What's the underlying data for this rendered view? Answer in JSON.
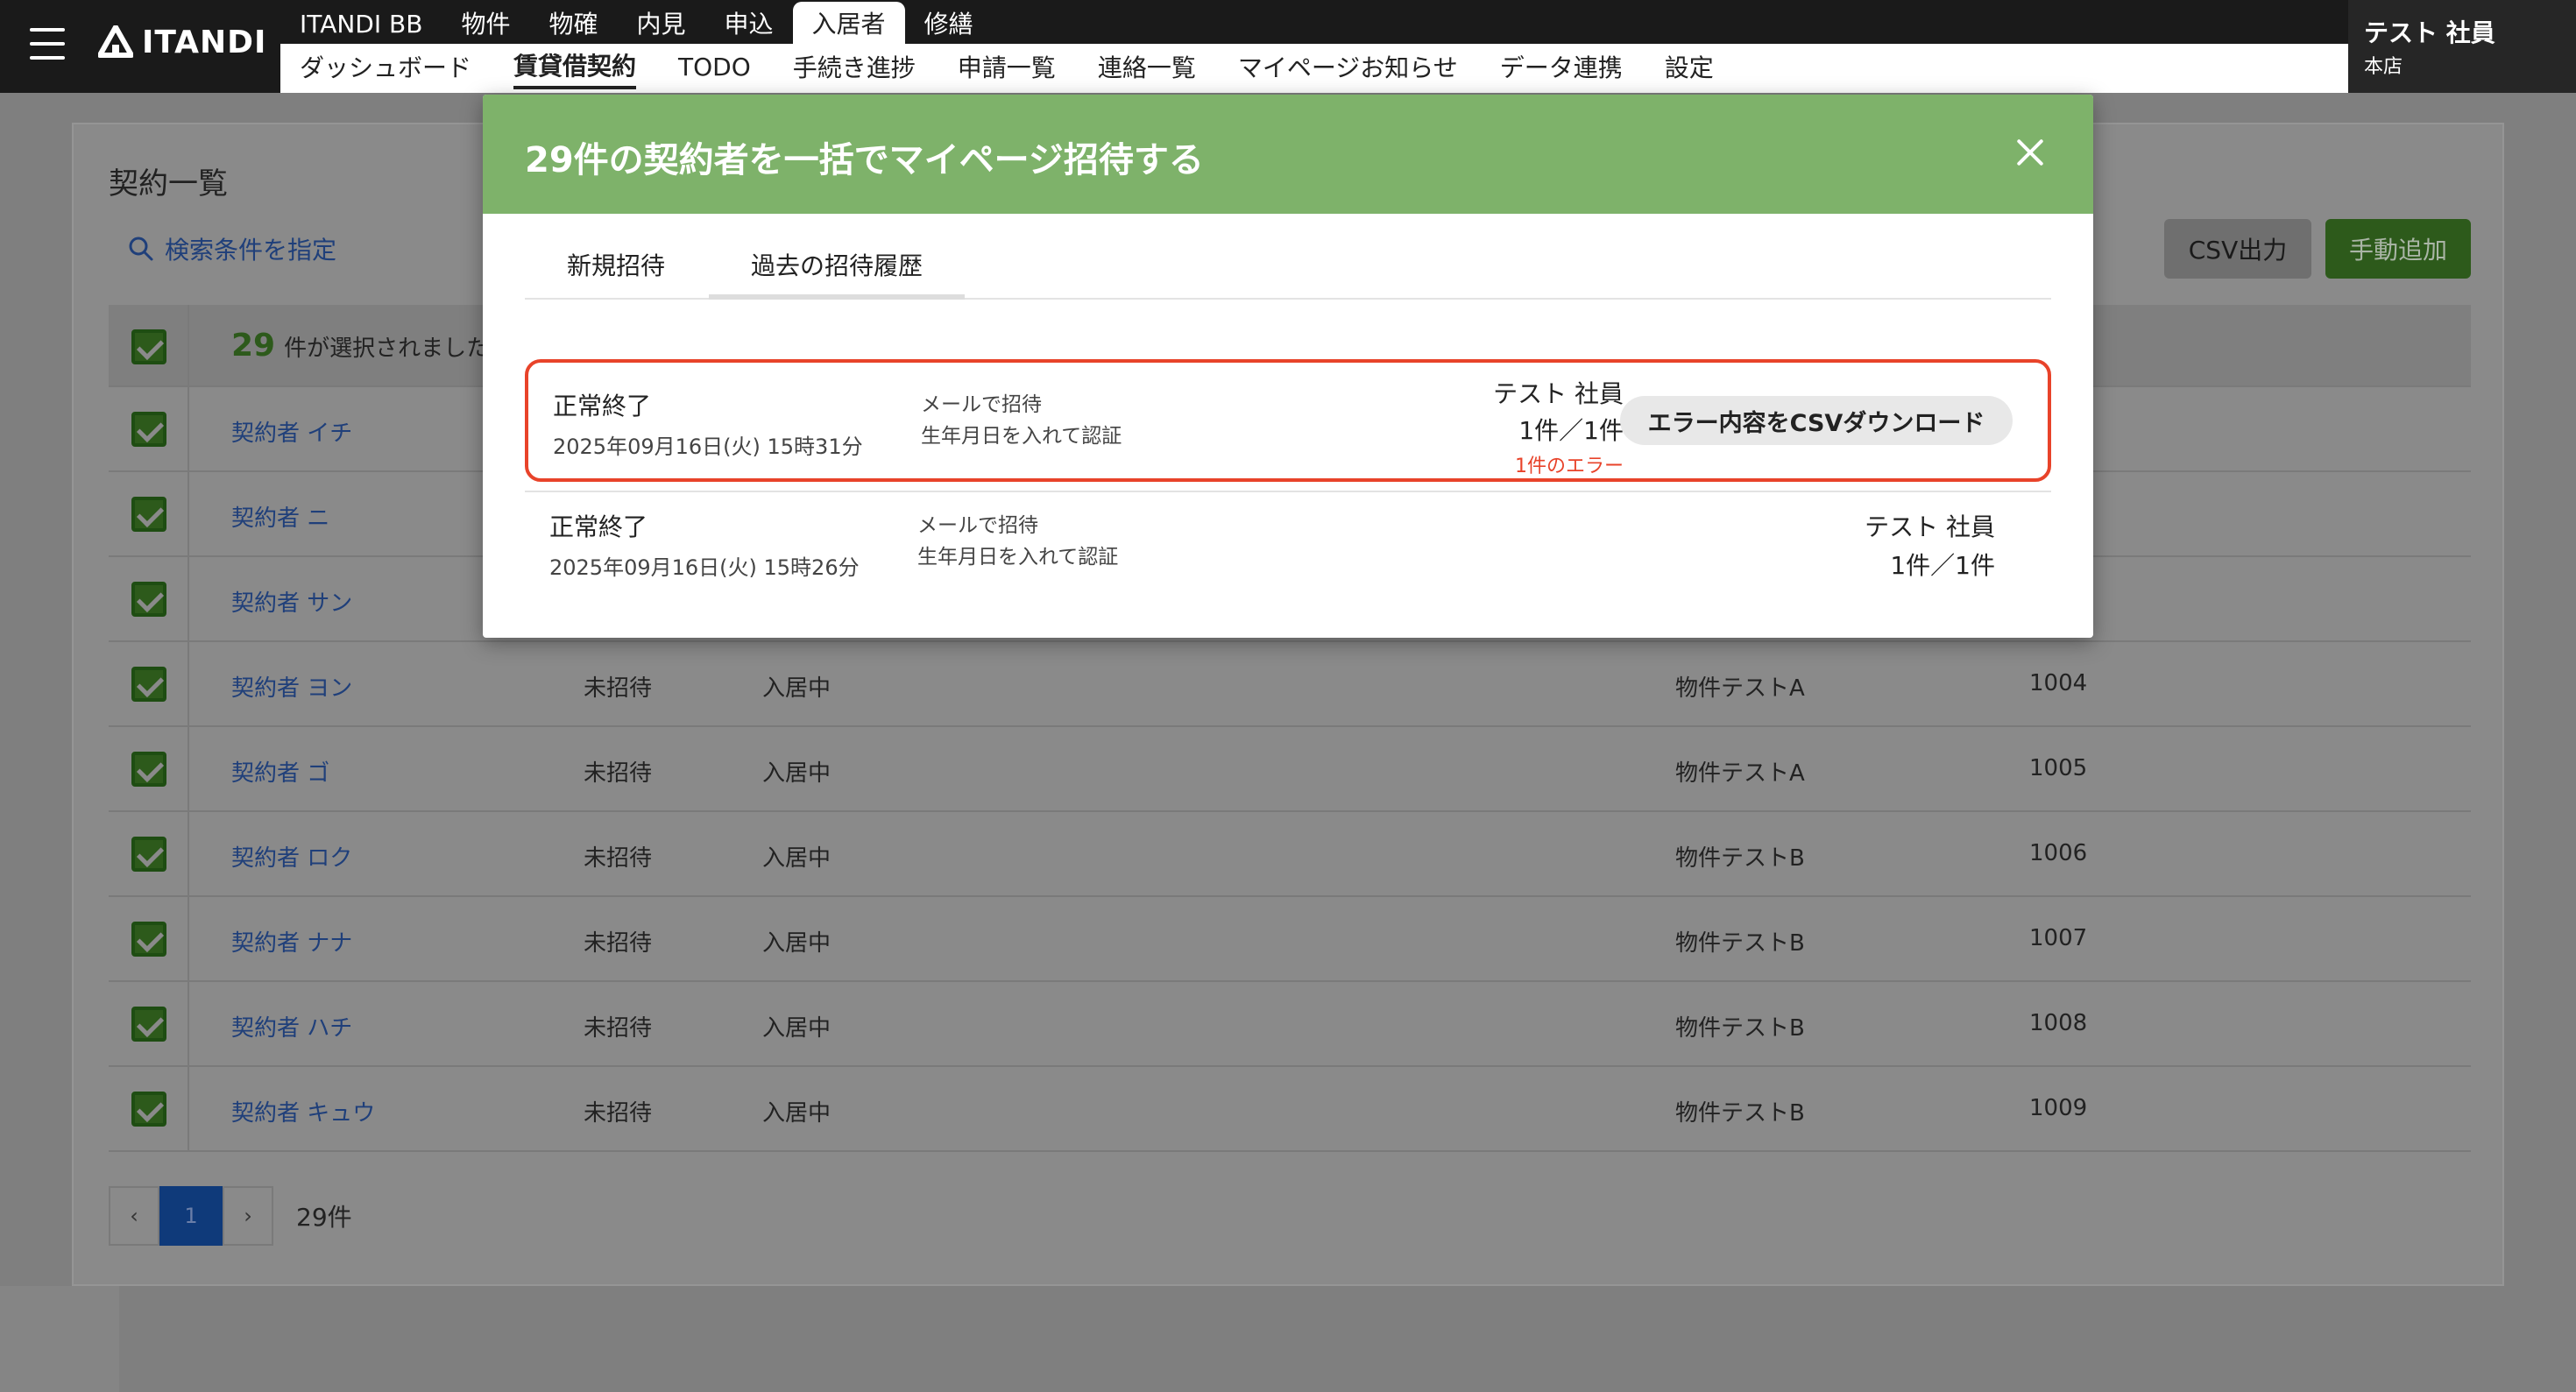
{
  "header": {
    "logo_text": "ITANDI",
    "top_tabs": [
      "ITANDI BB",
      "物件",
      "物確",
      "内見",
      "申込",
      "入居者",
      "修繕"
    ],
    "sub_nav": [
      "ダッシュボード",
      "賃貸借契約",
      "TODO",
      "手続き進捗",
      "申請一覧",
      "連絡一覧",
      "マイページお知らせ",
      "データ連携",
      "設定"
    ],
    "user_name": "テスト 社員",
    "user_store": "本店"
  },
  "page": {
    "title": "契約一覧",
    "search_label": "検索条件を指定",
    "csv_button": "CSV出力",
    "add_button": "手動追加",
    "selected_count": "29",
    "selected_suffix": "件が選択されました",
    "rows": [
      {
        "name": "契約者 イチ",
        "status": "",
        "state": "",
        "property": "",
        "room": ""
      },
      {
        "name": "契約者 ニ",
        "status": "",
        "state": "",
        "property": "",
        "room": ""
      },
      {
        "name": "契約者 サン",
        "status": "",
        "state": "",
        "property": "",
        "room": ""
      },
      {
        "name": "契約者 ヨン",
        "status": "未招待",
        "state": "入居中",
        "property": "物件テストA",
        "room": "1004"
      },
      {
        "name": "契約者 ゴ",
        "status": "未招待",
        "state": "入居中",
        "property": "物件テストA",
        "room": "1005"
      },
      {
        "name": "契約者 ロク",
        "status": "未招待",
        "state": "入居中",
        "property": "物件テストB",
        "room": "1006"
      },
      {
        "name": "契約者 ナナ",
        "status": "未招待",
        "state": "入居中",
        "property": "物件テストB",
        "room": "1007"
      },
      {
        "name": "契約者 ハチ",
        "status": "未招待",
        "state": "入居中",
        "property": "物件テストB",
        "room": "1008"
      },
      {
        "name": "契約者 キュウ",
        "status": "未招待",
        "state": "入居中",
        "property": "物件テストB",
        "room": "1009"
      }
    ],
    "pager": {
      "prev": "‹",
      "current": "1",
      "next": "›",
      "total": "29件"
    }
  },
  "modal": {
    "title": "29件の契約者を一括でマイページ招待する",
    "tabs": [
      "新規招待",
      "過去の招待履歴"
    ],
    "active_tab": "過去の招待履歴",
    "history": [
      {
        "status": "正常終了",
        "date": "2025年09月16日(火) 15時31分",
        "method_1": "メールで招待",
        "method_2": "生年月日を入れて認証",
        "user": "テスト 社員",
        "count": "1件／1件",
        "error": "1件のエラー",
        "download": "エラー内容をCSVダウンロード"
      },
      {
        "status": "正常終了",
        "date": "2025年09月16日(火) 15時26分",
        "method_1": "メールで招待",
        "method_2": "生年月日を入れて認証",
        "user": "テスト 社員",
        "count": "1件／1件"
      }
    ]
  },
  "colors": {
    "modal_header": "#7eb26a",
    "error_highlight": "#e8432a",
    "link": "#1f3f7a",
    "brand_green": "#2d5a1b"
  }
}
